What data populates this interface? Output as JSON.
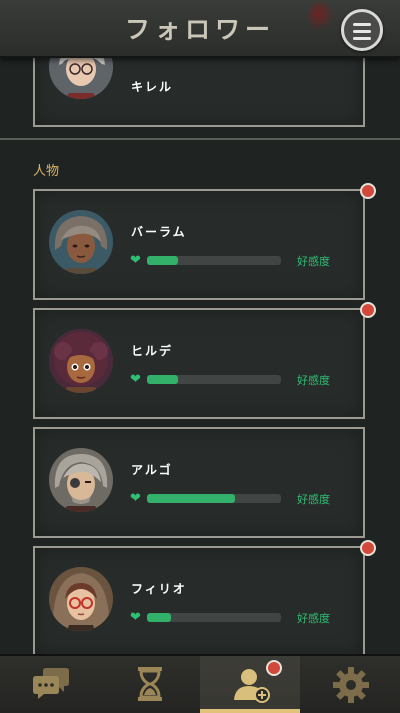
{
  "header": {
    "title": "フォロワー",
    "menu_icon": "hamburger-icon"
  },
  "followers_section": {
    "partial_follower": {
      "name": "キレル"
    }
  },
  "people_section": {
    "label": "人物",
    "characters": [
      {
        "name": "バーラム",
        "affection": 0.23,
        "affection_label": "好感度",
        "has_notification": true
      },
      {
        "name": "ヒルデ",
        "affection": 0.23,
        "affection_label": "好感度",
        "has_notification": true
      },
      {
        "name": "アルゴ",
        "affection": 0.66,
        "affection_label": "好感度",
        "has_notification": false
      },
      {
        "name": "フィリオ",
        "affection": 0.18,
        "affection_label": "好感度",
        "has_notification": true
      }
    ]
  },
  "bottom_nav": {
    "items": [
      {
        "icon": "chat-bubbles-icon",
        "active": false
      },
      {
        "icon": "hourglass-icon",
        "active": false
      },
      {
        "icon": "add-follower-icon",
        "active": true,
        "has_notification": true
      },
      {
        "icon": "gear-icon",
        "active": false
      }
    ]
  },
  "colors": {
    "accent": "#33b06a",
    "section_label": "#d8b46a",
    "notification": "#d2483a",
    "active_tab": "#e0c27a"
  }
}
